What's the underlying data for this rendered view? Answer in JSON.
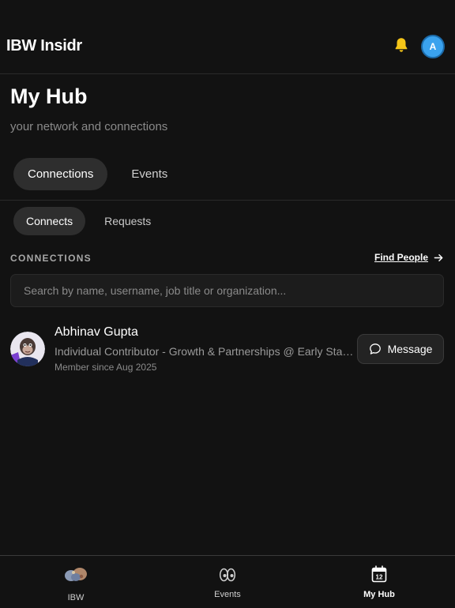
{
  "app": {
    "brand": "IBW Insidr",
    "user_initial": "A",
    "bell_color": "#f5c518",
    "avatar_color": "#3aa2ee"
  },
  "page": {
    "title": "My Hub",
    "subtitle": "your network and connections"
  },
  "main_tabs": [
    {
      "label": "Connections",
      "active": true
    },
    {
      "label": "Events",
      "active": false
    }
  ],
  "sub_tabs": [
    {
      "label": "Connects",
      "active": true
    },
    {
      "label": "Requests",
      "active": false
    }
  ],
  "connections_section": {
    "label": "CONNECTIONS",
    "find_people": "Find People",
    "search_placeholder": "Search by name, username, job title or organization..."
  },
  "connections": [
    {
      "name": "Abhinav Gupta",
      "title": "Individual Contributor - Growth & Partnerships @ Early Stage ...",
      "since": "Member since Aug 2025",
      "message_label": "Message",
      "avatar_icon": "cartoon-ape-avatar"
    }
  ],
  "bottom_nav": [
    {
      "label": "IBW",
      "icon": "ibw-logo-icon",
      "active": false
    },
    {
      "label": "Events",
      "icon": "eyes-icon",
      "active": false
    },
    {
      "label": "My Hub",
      "icon": "calendar-icon",
      "active": true,
      "badge": "12"
    }
  ]
}
